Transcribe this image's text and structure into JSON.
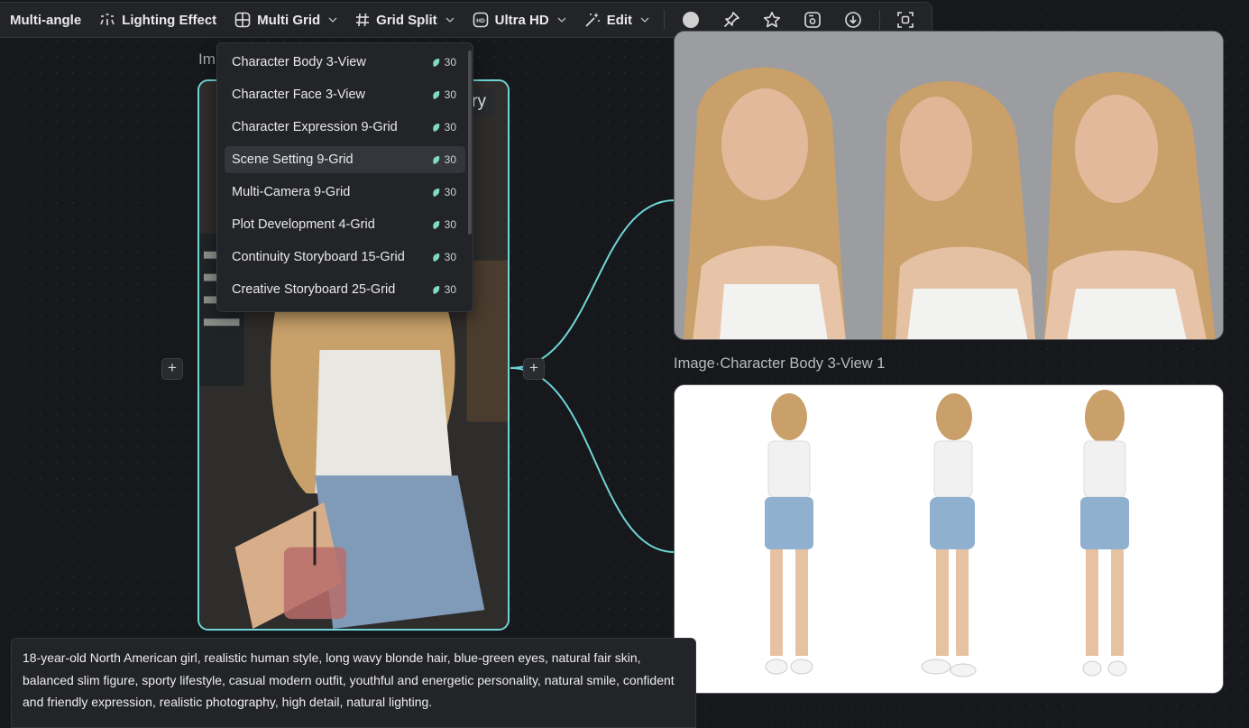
{
  "toolbar": {
    "items": [
      {
        "label": "Multi-angle",
        "icon": "none"
      },
      {
        "label": "Lighting Effect",
        "icon": "lighting-icon"
      },
      {
        "label": "Multi Grid",
        "icon": "grid-icon"
      },
      {
        "label": "Grid Split",
        "icon": "hash-icon"
      },
      {
        "label": "Ultra HD",
        "icon": "hd-icon"
      },
      {
        "label": "Edit",
        "icon": "magic-wand-icon"
      }
    ],
    "actions": [
      "color-dot",
      "pin-icon",
      "star-icon",
      "save-icon",
      "download-icon",
      "fullscreen-icon"
    ]
  },
  "dropdown": {
    "items": [
      {
        "label": "Character Body 3-View",
        "cost": "30"
      },
      {
        "label": "Character Face 3-View",
        "cost": "30"
      },
      {
        "label": "Character Expression 9-Grid",
        "cost": "30"
      },
      {
        "label": "Scene Setting 9-Grid",
        "cost": "30",
        "active": true
      },
      {
        "label": "Multi-Camera 9-Grid",
        "cost": "30"
      },
      {
        "label": "Plot Development 4-Grid",
        "cost": "30"
      },
      {
        "label": "Continuity Storyboard 15-Grid",
        "cost": "30"
      },
      {
        "label": "Creative Storyboard 25-Grid",
        "cost": "30"
      }
    ]
  },
  "left_node": {
    "label": "Im",
    "chip": "ry"
  },
  "right_node": {
    "label": "Image·Character Body 3-View 1"
  },
  "prompt": {
    "text": "18-year-old North American girl, realistic human style, long wavy blonde hair, blue-green eyes, natural fair skin, balanced slim figure, sporty lifestyle, casual modern outfit, youthful and energetic personality, natural smile, confident and friendly expression, realistic photography, high detail, natural lighting."
  },
  "colors": {
    "accent": "#6fd6d8",
    "background": "#17181b",
    "panel": "#232428",
    "leaf": "#7fd9c3"
  }
}
